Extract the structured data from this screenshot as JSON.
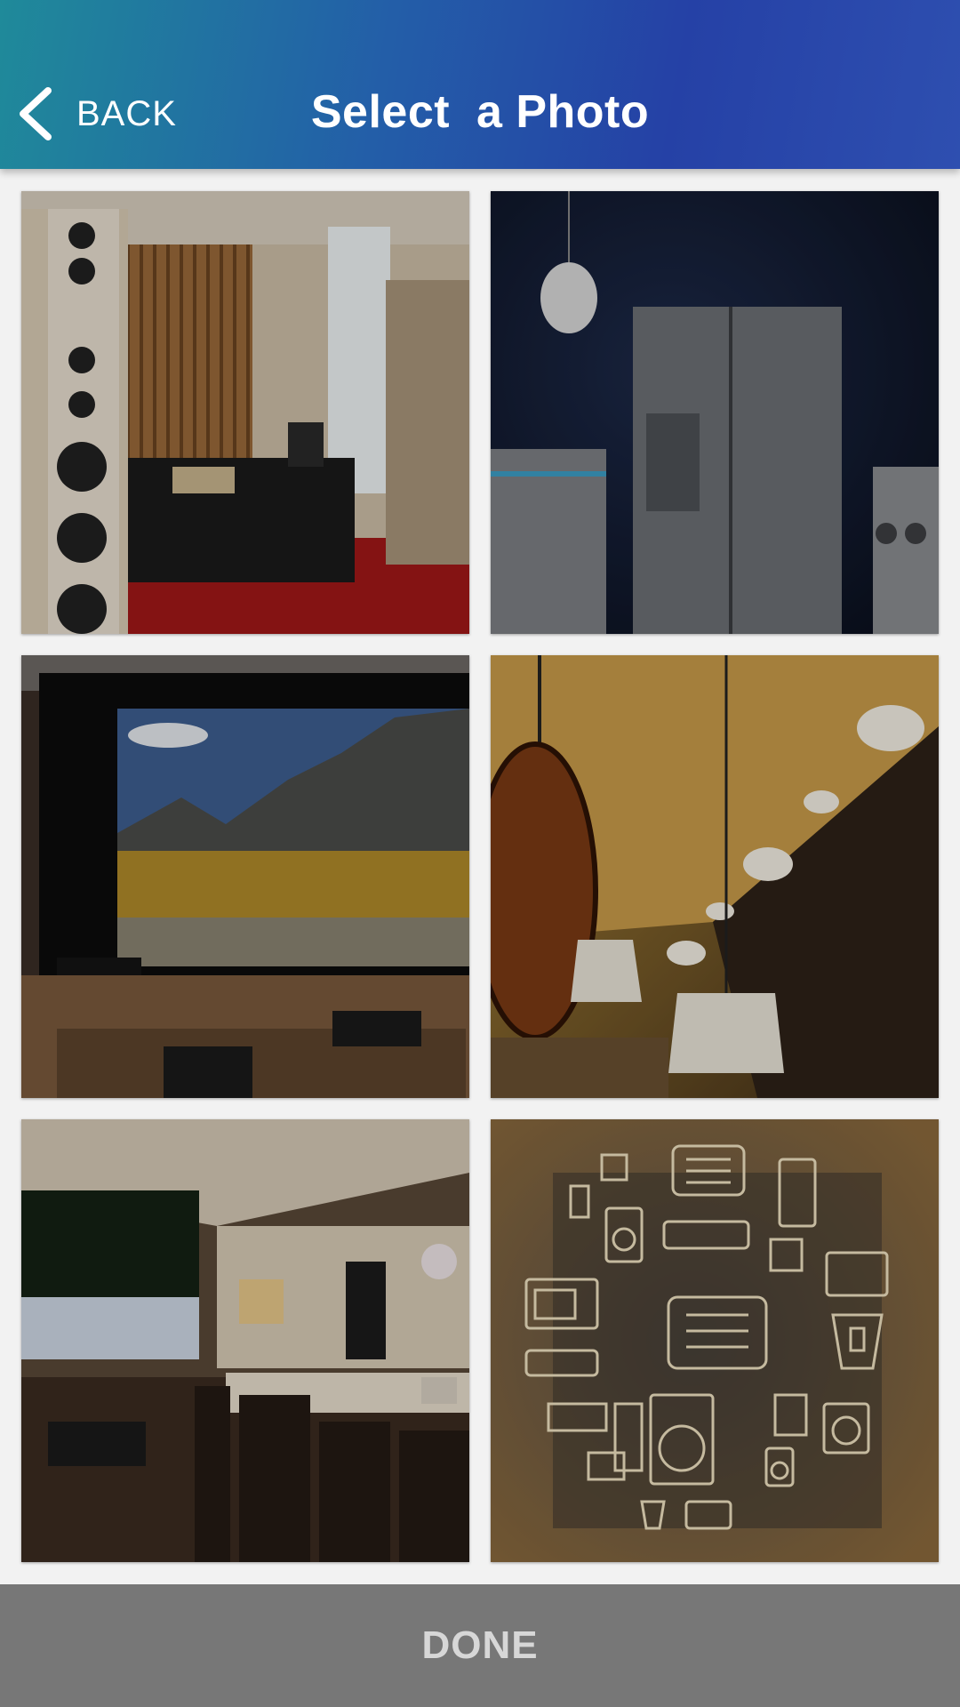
{
  "header": {
    "back_label": "BACK",
    "title": "Select  a Photo"
  },
  "photos": [
    {
      "subject": "home audio room with tower speakers and amplifiers"
    },
    {
      "subject": "stainless steel refrigerator in dark kitchen"
    },
    {
      "subject": "home theater screen showing mountain landscape"
    },
    {
      "subject": "pendant lights and recessed ceiling lighting"
    },
    {
      "subject": "open kitchen and living room at dusk"
    },
    {
      "subject": "line icons of home appliances"
    }
  ],
  "footer": {
    "done_label": "DONE"
  },
  "colors": {
    "header_start": "#1f8a9a",
    "header_end": "#2541a6",
    "done_bar": "#777777",
    "done_text": "#d7d7d7",
    "background": "#f2f2f2"
  }
}
